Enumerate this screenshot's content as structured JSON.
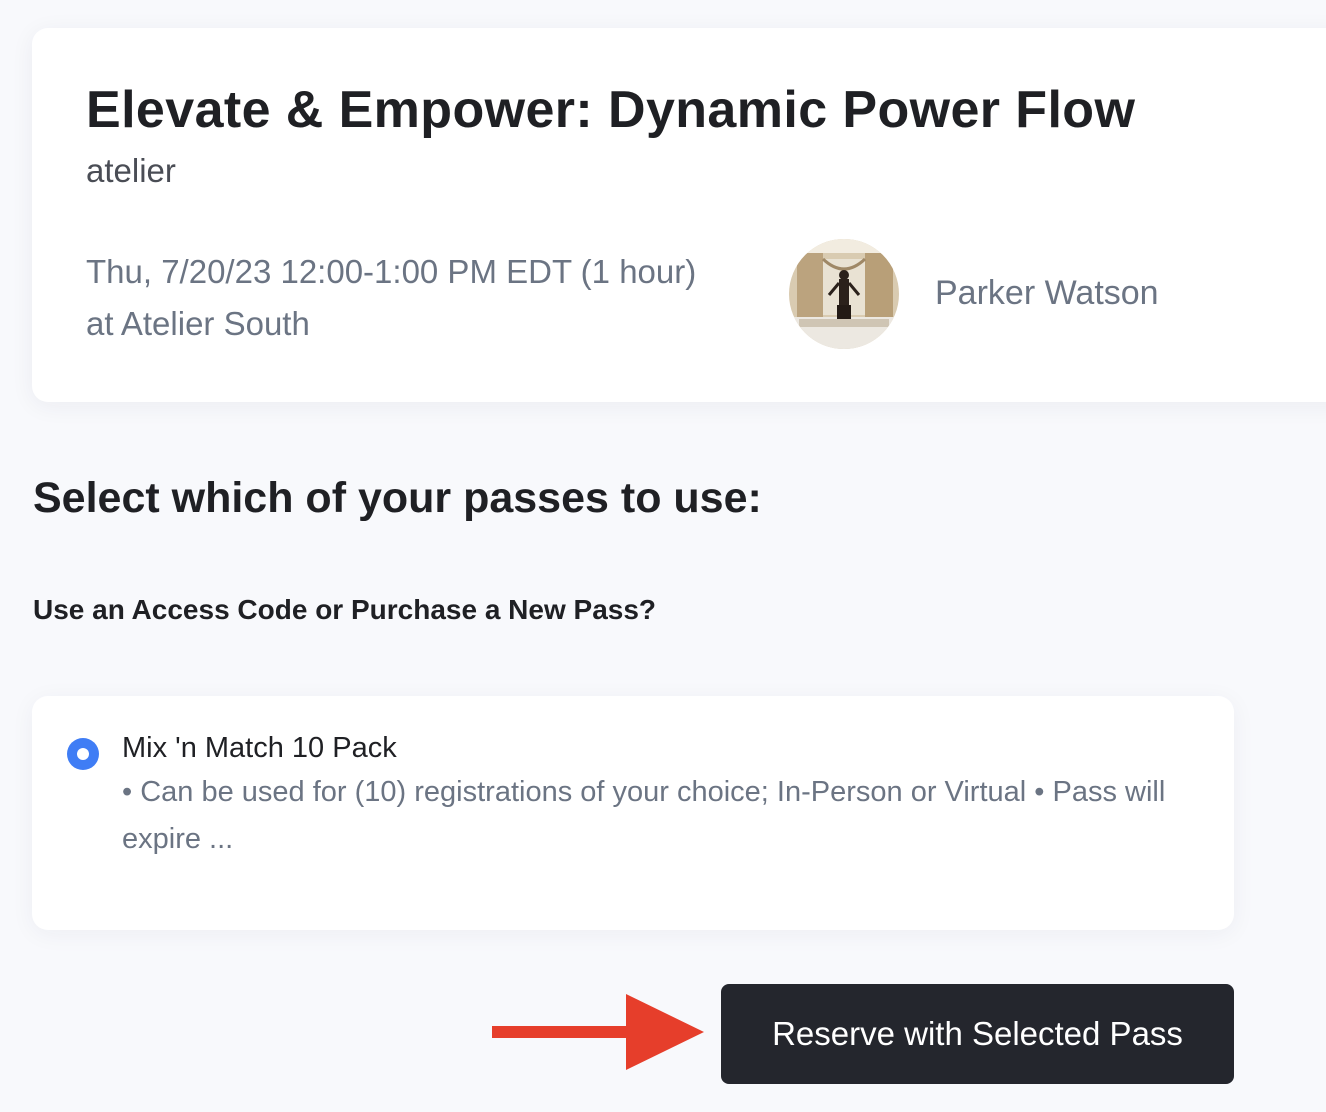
{
  "class": {
    "title": "Elevate & Empower: Dynamic Power Flow",
    "studio": "atelier",
    "datetime": "Thu, 7/20/23 12:00-1:00 PM EDT (1 hour)",
    "location": "at Atelier South",
    "instructor": "Parker Watson"
  },
  "passes": {
    "heading": "Select which of your passes to use:",
    "subheading": "Use an Access Code or Purchase a New Pass?",
    "selected_option": {
      "name": "Mix 'n Match 10 Pack",
      "description": "• Can be used for (10) registrations of your choice; In-Person or Virtual  • Pass will expire ..."
    }
  },
  "actions": {
    "reserve_label": "Reserve with Selected Pass"
  },
  "colors": {
    "radio_accent": "#3f7df5",
    "button_bg": "#24262d",
    "arrow": "#e63e2b",
    "page_bg": "#f8f9fc"
  }
}
